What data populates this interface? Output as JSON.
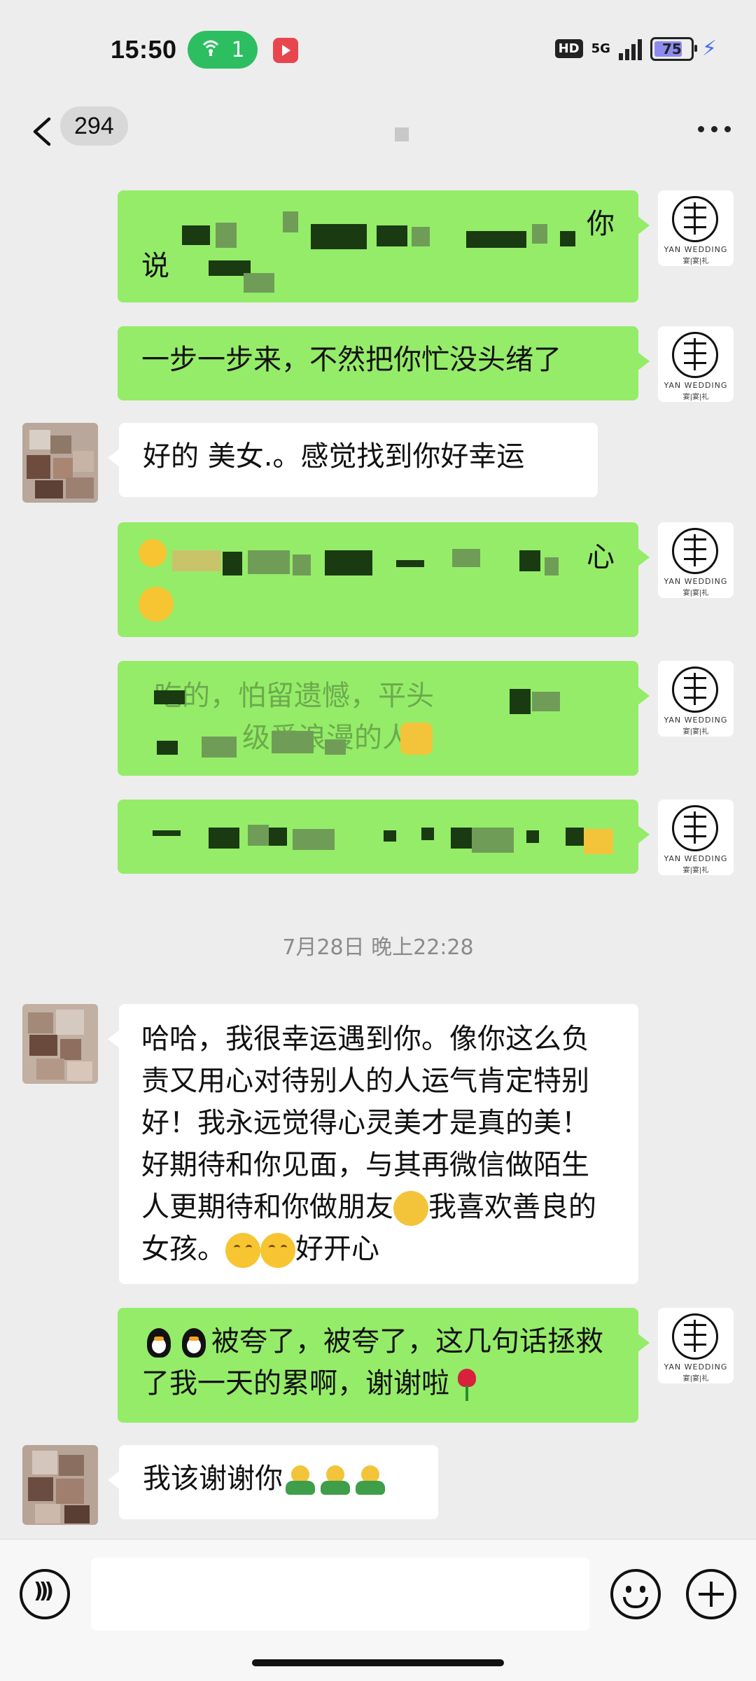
{
  "status": {
    "time": "15:50",
    "hotspot_count": "1",
    "hd": "HD",
    "network": "5G",
    "battery": "75"
  },
  "header": {
    "unread_count": "294"
  },
  "logo": {
    "line1": "YAN WEDDING",
    "line2": "宴|宴|礼"
  },
  "messages": {
    "m1": {
      "visible_start": "你",
      "visible_line2": "说"
    },
    "m2": {
      "text": "一步一步来，不然把你忙没头绪了"
    },
    "m3": {
      "text": "好的 美女.。感觉找到你好幸运"
    },
    "m4": {
      "visible_end": "心"
    },
    "m5": {
      "line1": "吃的，怕留遗憾，平头",
      "line2": "级爱浪漫的人"
    },
    "m6": {},
    "timestamp": "7月28日 晚上22:28",
    "m7": {
      "text_a": "哈哈，我很幸运遇到你。像你这么负责又用心对待别人的人运气肯定特别好！我永远觉得心灵美才是真的美！好期待和你见面，与其再微信做陌生人更期待和你做朋友",
      "text_b": "我喜欢善良的女孩。",
      "text_c": "好开心"
    },
    "m8": {
      "text": "被夸了，被夸了，这几句话拯救了我一天的累啊，谢谢啦"
    },
    "m9": {
      "text": "我该谢谢你"
    }
  }
}
